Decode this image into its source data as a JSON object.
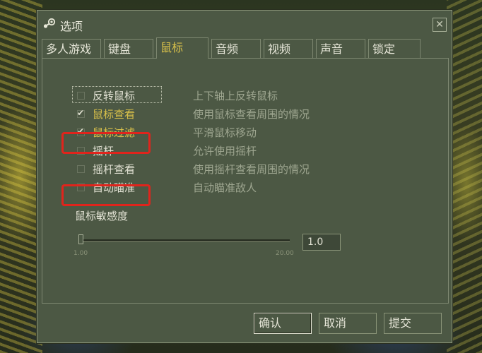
{
  "window": {
    "title": "选项",
    "icon": "steam-icon",
    "close_icon": "close-icon",
    "close_glyph": "✕"
  },
  "tabs": [
    {
      "label": "多人游戏",
      "active": false
    },
    {
      "label": "键盘",
      "active": false
    },
    {
      "label": "鼠标",
      "active": true
    },
    {
      "label": "音频",
      "active": false
    },
    {
      "label": "视频",
      "active": false
    },
    {
      "label": "声音",
      "active": false
    },
    {
      "label": "锁定",
      "active": false
    }
  ],
  "options": [
    {
      "label": "反转鼠标",
      "description": "上下轴上反转鼠标",
      "checked": false,
      "focused": true,
      "highlighted": false
    },
    {
      "label": "鼠标查看",
      "description": "使用鼠标查看周围的情况",
      "checked": true,
      "focused": false,
      "highlighted": false
    },
    {
      "label": "鼠标过滤",
      "description": "平滑鼠标移动",
      "checked": true,
      "focused": false,
      "highlighted": true
    },
    {
      "label": "摇杆",
      "description": "允许使用摇杆",
      "checked": false,
      "focused": false,
      "highlighted": false
    },
    {
      "label": "摇杆查看",
      "description": "使用摇杆查看周围的情况",
      "checked": false,
      "focused": false,
      "highlighted": false
    },
    {
      "label": "自动瞄准",
      "description": "自动瞄准敌人",
      "checked": false,
      "focused": false,
      "highlighted": true
    }
  ],
  "sensitivity": {
    "label": "鼠标敏感度",
    "value": "1.0",
    "min_label": "1.00",
    "max_label": "20.00",
    "min": 1.0,
    "max": 20.0,
    "current": 1.0
  },
  "buttons": {
    "ok": "确认",
    "cancel": "取消",
    "apply": "提交"
  },
  "colors": {
    "accent": "#d8c04a",
    "highlight": "#e0241c",
    "dialog_bg": "#4c5844"
  }
}
